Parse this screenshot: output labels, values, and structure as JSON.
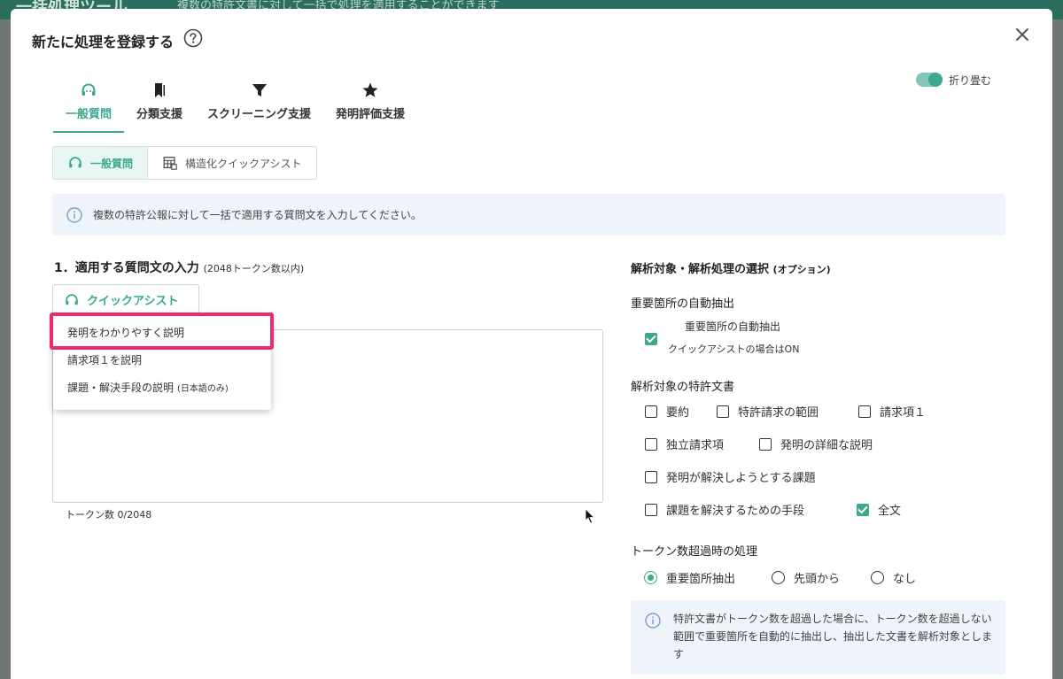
{
  "background": {
    "app_title": "一括処理ツール",
    "app_subtitle": "複数の特許文書に対して一括で処理を適用することができます"
  },
  "modal": {
    "title": "新たに処理を登録する",
    "collapse_label": "折り畳む"
  },
  "tabs": [
    {
      "label": "一般質問",
      "icon": "headset-icon",
      "active": true
    },
    {
      "label": "分類支援",
      "icon": "bookmark-icon",
      "active": false
    },
    {
      "label": "スクリーニング支援",
      "icon": "filter-icon",
      "active": false
    },
    {
      "label": "発明評価支援",
      "icon": "star-icon",
      "active": false
    }
  ],
  "subtabs": [
    {
      "label": "一般質問",
      "icon": "headset-icon",
      "active": true
    },
    {
      "label": "構造化クイックアシスト",
      "icon": "table-icon",
      "active": false
    }
  ],
  "info_message": "複数の特許公報に対して一括で適用する質問文を入力してください。",
  "left": {
    "section_title": "1．適用する質問文の入力",
    "section_subtitle": "(2048トークン数以内)",
    "quick_assist_label": "クイックアシスト",
    "dropdown_items": [
      {
        "label": "発明をわかりやすく説明",
        "note": ""
      },
      {
        "label": "請求項１を説明",
        "note": ""
      },
      {
        "label": "課題・解決手段の説明",
        "note": "(日本語のみ)"
      }
    ],
    "token_count": "トークン数 0/2048"
  },
  "right": {
    "section_title": "解析対象・解析処理の選択",
    "section_subtitle": "(オプション)",
    "auto_extract": {
      "heading": "重要箇所の自動抽出",
      "checkbox_label": "重要箇所の自動抽出",
      "note": "クイックアシストの場合はON",
      "checked": true
    },
    "documents": {
      "heading": "解析対象の特許文書",
      "items": [
        {
          "label": "要約",
          "checked": false
        },
        {
          "label": "特許請求の範囲",
          "checked": false
        },
        {
          "label": "請求項１",
          "checked": false
        },
        {
          "label": "独立請求項",
          "checked": false
        },
        {
          "label": "発明の詳細な説明",
          "checked": false
        },
        {
          "label": "発明が解決しようとする課題",
          "checked": false
        },
        {
          "label": "課題を解決するための手段",
          "checked": false
        },
        {
          "label": "全文",
          "checked": true
        }
      ]
    },
    "overflow": {
      "heading": "トークン数超過時の処理",
      "options": [
        {
          "label": "重要箇所抽出",
          "selected": true
        },
        {
          "label": "先頭から",
          "selected": false
        },
        {
          "label": "なし",
          "selected": false
        }
      ]
    },
    "note": "特許文書がトークン数を超過した場合に、トークン数を超過しない範囲で重要箇所を自動的に抽出し、抽出した文書を解析対象とします"
  },
  "colors": {
    "accent": "#3ba88f",
    "highlight": "#ee2d68",
    "info_bg": "#eff4fb"
  }
}
